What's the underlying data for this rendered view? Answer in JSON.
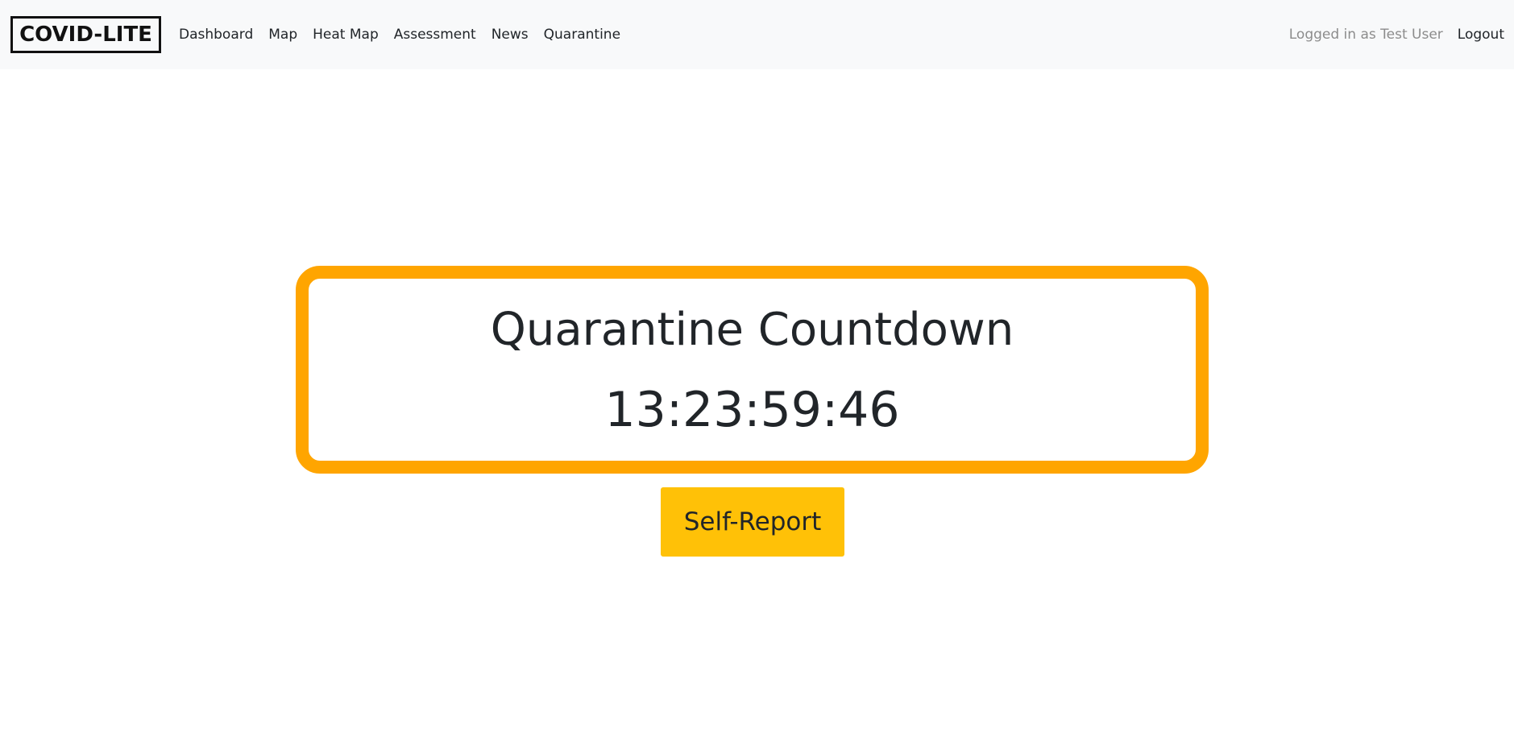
{
  "navbar": {
    "brand": "COVID-LITE",
    "links": [
      {
        "label": "Dashboard"
      },
      {
        "label": "Map"
      },
      {
        "label": "Heat Map"
      },
      {
        "label": "Assessment"
      },
      {
        "label": "News"
      },
      {
        "label": "Quarantine"
      }
    ],
    "logged_in_text": "Logged in as Test User",
    "logout_label": "Logout"
  },
  "countdown": {
    "title": "Quarantine Countdown",
    "time": "13:23:59:46",
    "border_color": "#ffa500"
  },
  "actions": {
    "self_report_label": "Self-Report",
    "button_color": "#ffc107"
  }
}
